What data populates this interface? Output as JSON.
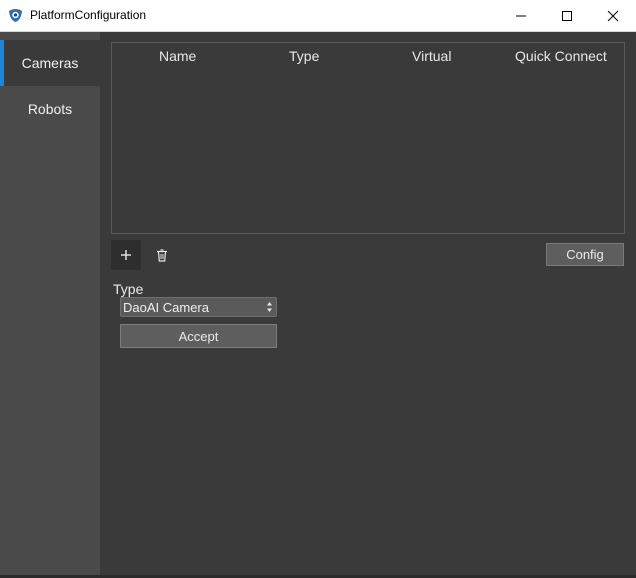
{
  "window": {
    "title": "PlatformConfiguration",
    "icons": [
      "app-icon",
      "minimize-icon",
      "maximize-icon",
      "close-icon"
    ]
  },
  "sidebar": {
    "items": [
      {
        "label": "Cameras",
        "selected": true
      },
      {
        "label": "Robots",
        "selected": false
      }
    ],
    "accent_color": "#1d86d6"
  },
  "table": {
    "columns": [
      "Name",
      "Type",
      "Virtual",
      "Quick Connect"
    ],
    "rows": []
  },
  "toolbar": {
    "add_icon": "plus-icon",
    "delete_icon": "trash-icon",
    "config_label": "Config"
  },
  "form": {
    "type_label": "Type",
    "type_value": "DaoAI Camera",
    "accept_label": "Accept"
  }
}
